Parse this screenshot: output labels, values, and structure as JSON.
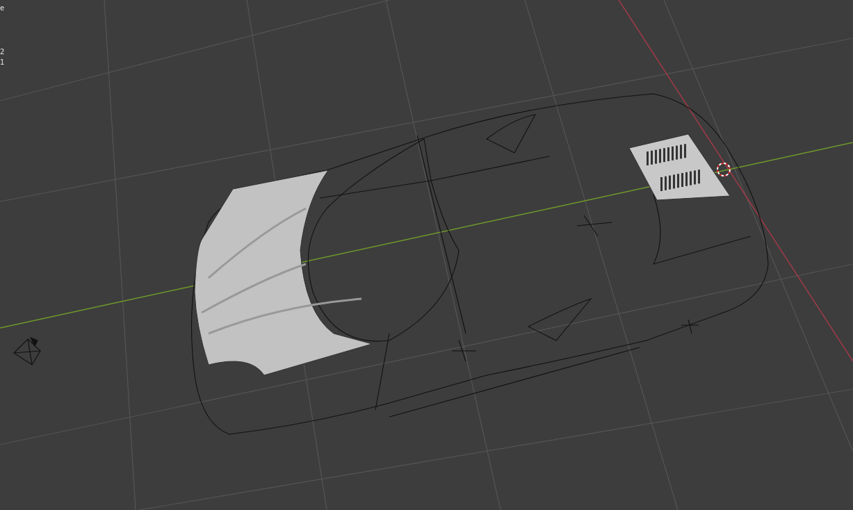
{
  "viewport": {
    "overlay_texts": [
      "e",
      "2",
      "1"
    ]
  }
}
